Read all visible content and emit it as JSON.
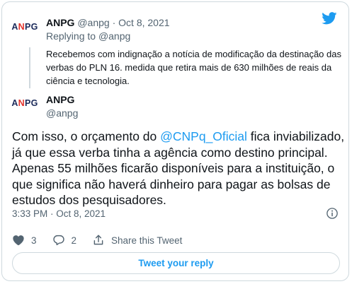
{
  "quoted_tweet": {
    "author_name": "ANPG",
    "author_handle": "@anpg",
    "separator": " · ",
    "date": "Oct 8, 2021",
    "replying_prefix": "Replying to ",
    "replying_to": "@anpg",
    "text": "Recebemos com indignação a notícia de modificação da destinação das verbas do PLN 16. medida que retira mais de 630 milhões de reais da ciência e tecnologia."
  },
  "main_tweet": {
    "author_name": "ANPG",
    "author_handle": "@anpg",
    "text_before": "Com isso, o orçamento do ",
    "mention": "@CNPq_Oficial",
    "text_after": " fica inviabilizado, já que essa verba tinha a agência como destino principal. Apenas 55 milhões ficarão disponíveis para a instituição, o que significa não haverá dinheiro para pagar as bolsas de estudos dos pesquisadores.",
    "timestamp": "3:33 PM · Oct 8, 2021"
  },
  "avatar": {
    "logo_a": "A",
    "logo_n": "N",
    "logo_pg": "PG"
  },
  "actions": {
    "like_count": "3",
    "reply_count": "2",
    "share_label": "Share this Tweet"
  },
  "reply_button_label": "Tweet your reply",
  "colors": {
    "accent": "#1d9bf0",
    "like": "#536471",
    "text": "#0f1419",
    "muted": "#536471",
    "border": "#cfd9de"
  },
  "icons": [
    "twitter-bird-icon",
    "heart-icon",
    "reply-bubble-icon",
    "share-icon",
    "info-icon"
  ]
}
